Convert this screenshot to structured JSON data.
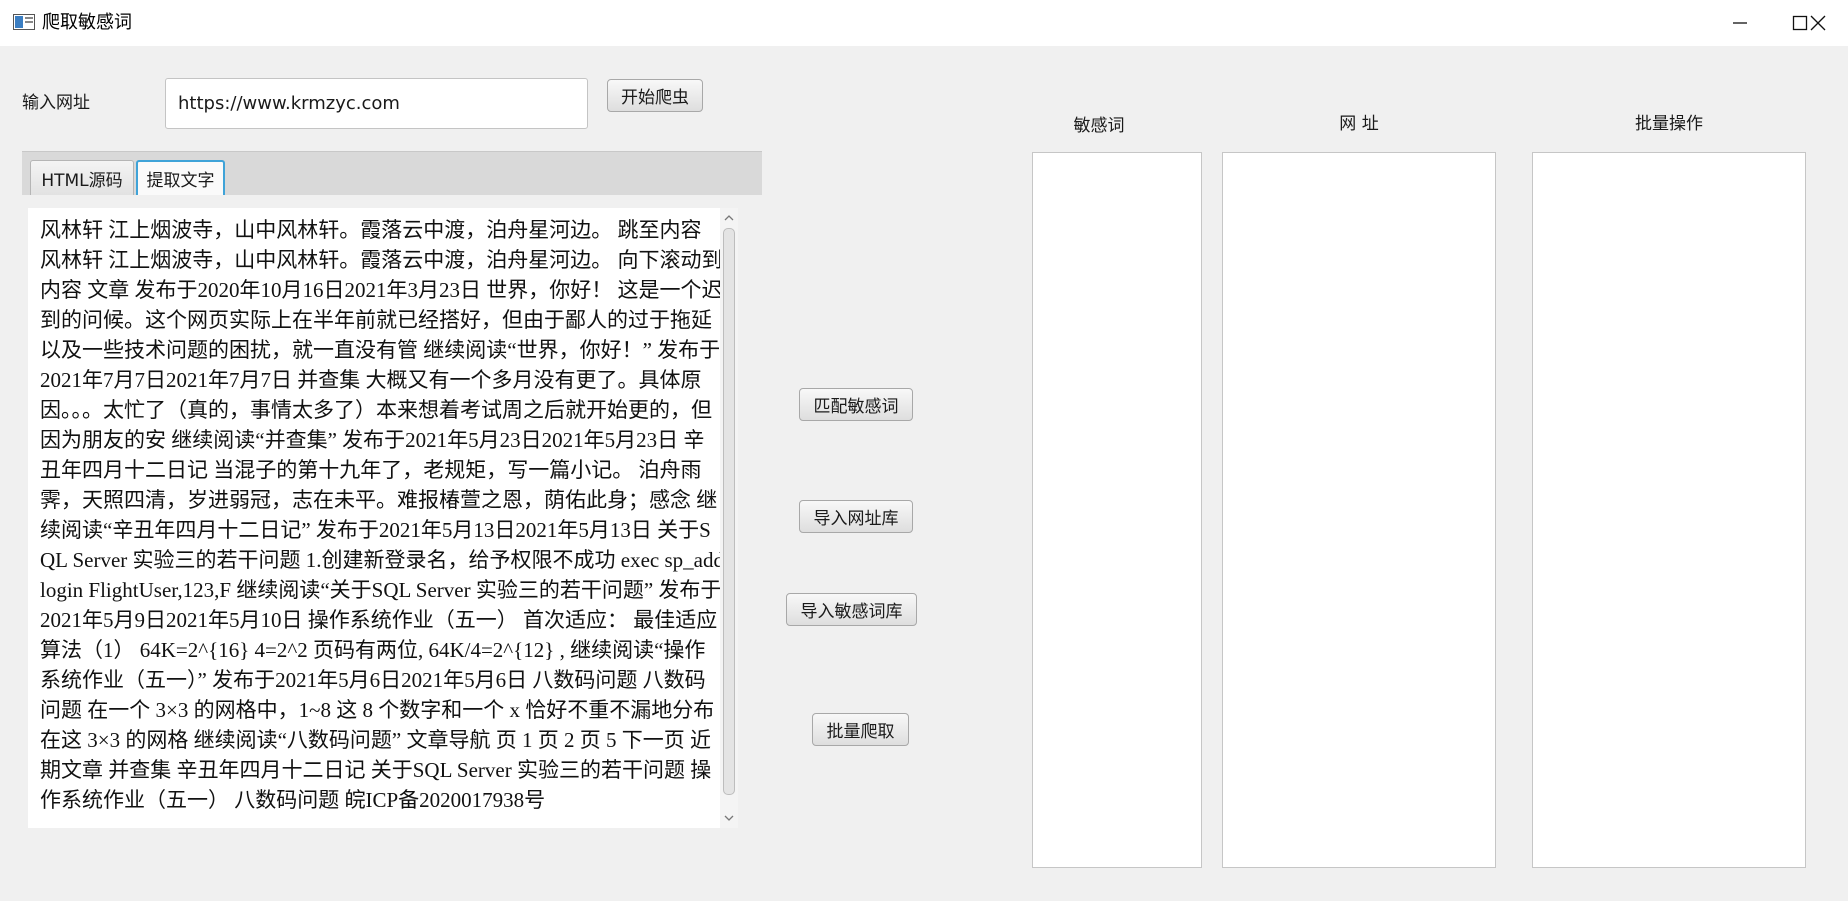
{
  "window": {
    "title": "爬取敏感词"
  },
  "url_row": {
    "label": "输入网址",
    "input_value": "https://www.krmzyc.com",
    "start_button": "开始爬虫"
  },
  "tabs": [
    {
      "label": "HTML源码",
      "active": false
    },
    {
      "label": "提取文字",
      "active": true
    }
  ],
  "extracted_text": "风林轩 江上烟波寺，山中风林轩。霞落云中渡，泊舟星河边。 跳至内容 风林轩 江上烟波寺，山中风林轩。霞落云中渡，泊舟星河边。 向下滚动到内容 文章 发布于2020年10月16日2021年3月23日 世界，你好！ 这是一个迟到的问候。这个网页实际上在半年前就已经搭好，但由于鄙人的过于拖延以及一些技术问题的困扰，就一直没有管 继续阅读“世界，你好！” 发布于2021年7月7日2021年7月7日 并查集 大概又有一个多月没有更了。具体原因。。。太忙了（真的，事情太多了）本来想着考试周之后就开始更的，但因为朋友的安 继续阅读“并查集” 发布于2021年5月23日2021年5月23日 辛丑年四月十二日记 当混子的第十九年了，老规矩，写一篇小记。 泊舟雨霁，天照四清，岁进弱冠，志在未平。难报椿萱之恩，荫佑此身；感念 继续阅读“辛丑年四月十二日记” 发布于2021年5月13日2021年5月13日 关于SQL Server 实验三的若干问题 1.创建新登录名，给予权限不成功 exec sp_addlogin FlightUser,123,F 继续阅读“关于SQL Server 实验三的若干问题” 发布于2021年5月9日2021年5月10日 操作系统作业（五一） 首次适应： 最佳适应算法（1） 64K=2^{16} 4=2^2 页码有两位, 64K/4=2^{12} , 继续阅读“操作系统作业（五一）” 发布于2021年5月6日2021年5月6日 八数码问题 八数码问题 在一个 3×3 的网格中，1~8 这 8 个数字和一个 x 恰好不重不漏地分布在这 3×3 的网格 继续阅读“八数码问题” 文章导航 页 1 页 2 页 5 下一页 近期文章 并查集 辛丑年四月十二日记 关于SQL Server 实验三的若干问题 操作系统作业（五一） 八数码问题 皖ICP备2020017938号",
  "actions": {
    "match": "匹配敏感词",
    "import_urls": "导入网址库",
    "import_words": "导入敏感词库",
    "batch": "批量爬取"
  },
  "columns": {
    "words": "敏感词",
    "urls": "网 址",
    "batch": "批量操作"
  },
  "colors": {
    "tab_active_border": "#3fa3d8",
    "background": "#f0f0f0"
  }
}
